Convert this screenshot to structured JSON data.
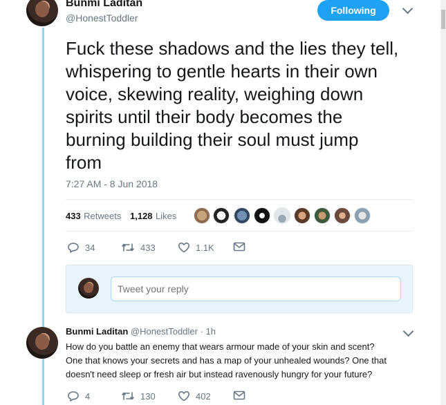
{
  "tweet": {
    "author_name": "Bunmi Laditan",
    "author_handle": "@HonestToddler",
    "follow_label": "Following",
    "text": "Fuck these shadows and the lies they tell,\nwhispering to gentle hearts in their own\nvoice, skewing reality, weighing down\nspirits until their body becomes the\nburning building their soul must jump\nfrom",
    "timestamp": "7:27 AM - 8 Jun 2018",
    "retweets_count": "433",
    "retweets_label": "Retweets",
    "likes_count": "1,128",
    "likes_label": "Likes",
    "actions": {
      "reply_count": "34",
      "retweet_count": "433",
      "like_count": "1.1K"
    }
  },
  "reply_composer": {
    "placeholder": "Tweet your reply"
  },
  "reply_tweet": {
    "author_name": "Bunmi Laditan",
    "author_handle": "@HonestToddler",
    "separator": "·",
    "time": "1h",
    "text": "How do you battle an enemy that wears armour made of your skin and scent?\nOne that knows your secrets and has a map of your unhealed wounds? One that\ndoesn't need sleep or fresh air but instead ravenously hungry for your future?",
    "actions": {
      "reply_count": "4",
      "retweet_count": "130",
      "like_count": "402"
    }
  },
  "colors": {
    "accent": "#1da1f2",
    "thread_line": "#9ad4ee",
    "muted_text": "#657786"
  }
}
